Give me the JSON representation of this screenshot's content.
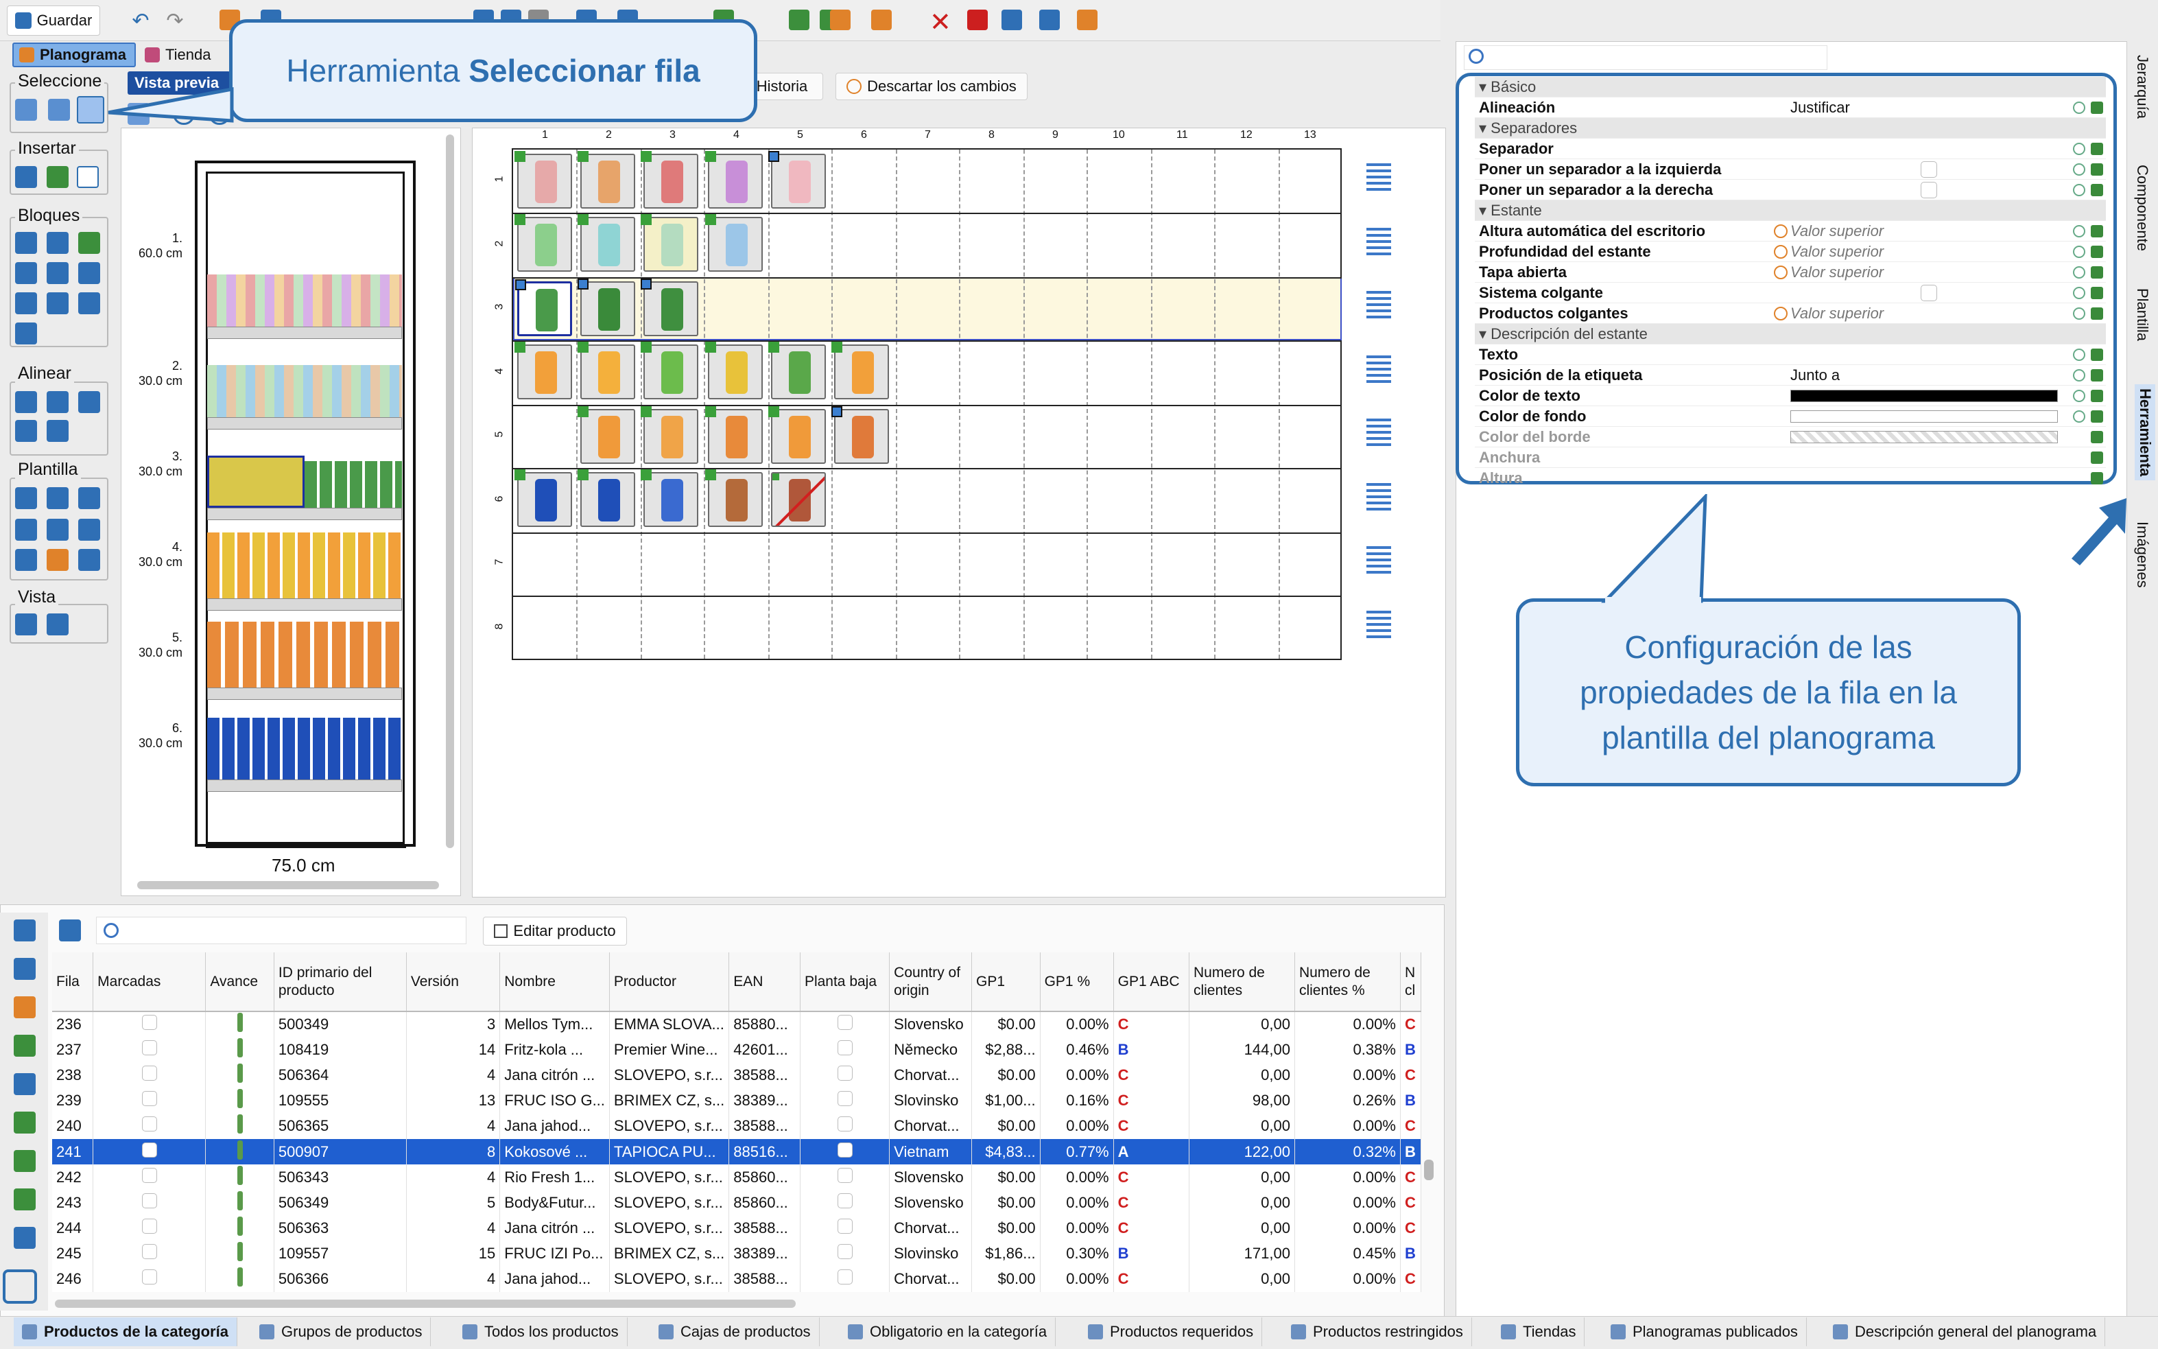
{
  "toolbar": {
    "save_label": "Guardar",
    "tab_planogram": "Planograma",
    "tab_store": "Tienda",
    "subtab_preview": "Vista previa",
    "history_label": "Historia",
    "discard_label": "Descartar los cambios"
  },
  "left_tools": {
    "groups": [
      "Seleccione",
      "Insertar",
      "Bloques",
      "Alinear",
      "Plantilla",
      "Vista"
    ]
  },
  "preview": {
    "shelves": [
      {
        "label": "1.",
        "height": "60.0 cm"
      },
      {
        "label": "2.",
        "height": "30.0 cm"
      },
      {
        "label": "3.",
        "height": "30.0 cm"
      },
      {
        "label": "4.",
        "height": "30.0 cm"
      },
      {
        "label": "5.",
        "height": "30.0 cm"
      },
      {
        "label": "6.",
        "height": "30.0 cm"
      }
    ],
    "width_label": "75.0 cm"
  },
  "grid": {
    "columns": [
      "1",
      "2",
      "3",
      "4",
      "5",
      "6",
      "7",
      "8",
      "9",
      "10",
      "11",
      "12",
      "13"
    ],
    "rows": [
      "1",
      "2",
      "3",
      "4",
      "5",
      "6",
      "7",
      "8"
    ]
  },
  "callouts": {
    "tool_title_prefix": "Herramienta ",
    "tool_title_bold": "Seleccionar fila",
    "config_text": "Configuración de las propiedades de la fila en la plantilla del planograma"
  },
  "properties": {
    "rows": [
      {
        "kind": "section",
        "name": "Básico"
      },
      {
        "kind": "prop",
        "name": "Alineación",
        "value": "Justificar"
      },
      {
        "kind": "section",
        "name": "Separadores"
      },
      {
        "kind": "prop",
        "name": "Separador",
        "value": ""
      },
      {
        "kind": "prop",
        "name": "Poner un separador a la izquierda",
        "value": "",
        "checkbox": true
      },
      {
        "kind": "prop",
        "name": "Poner un separador a la derecha",
        "value": "",
        "checkbox": true
      },
      {
        "kind": "section",
        "name": "Estante"
      },
      {
        "kind": "prop",
        "name": "Altura automática del escritorio",
        "value": "Valor superior",
        "inherit": true
      },
      {
        "kind": "prop",
        "name": "Profundidad del estante",
        "value": "Valor superior",
        "inherit": true
      },
      {
        "kind": "prop",
        "name": "Tapa abierta",
        "value": "Valor superior",
        "inherit": true
      },
      {
        "kind": "prop",
        "name": "Sistema colgante",
        "value": "",
        "checkbox": true
      },
      {
        "kind": "prop",
        "name": "Productos colgantes",
        "value": "Valor superior",
        "inherit": true
      },
      {
        "kind": "section",
        "name": "Descripción del estante"
      },
      {
        "kind": "prop",
        "name": "Texto",
        "value": ""
      },
      {
        "kind": "prop",
        "name": "Posición de la etiqueta",
        "value": "Junto a"
      },
      {
        "kind": "prop",
        "name": "Color de texto",
        "value": "",
        "swatch": "#000000"
      },
      {
        "kind": "prop",
        "name": "Color de fondo",
        "value": "",
        "swatch": "#ffffff"
      },
      {
        "kind": "prop",
        "name": "Color del borde",
        "value": "",
        "swatch": "checker",
        "disabled": true
      },
      {
        "kind": "prop",
        "name": "Anchura",
        "value": "",
        "disabled": true
      },
      {
        "kind": "prop",
        "name": "Altura",
        "value": "",
        "disabled": true
      }
    ]
  },
  "right_tabs": [
    "Jerarquía",
    "Componente",
    "Plantilla",
    "Herramienta",
    "Imágenes"
  ],
  "products_table": {
    "edit_button": "Editar producto",
    "headers": [
      "Fila",
      "Marcadas",
      "Avance",
      "ID primario del producto",
      "Versión",
      "Nombre",
      "Productor",
      "EAN",
      "Planta baja",
      "Country of origin",
      "GP1",
      "GP1 %",
      "GP1 ABC",
      "Numero de clientes",
      "Numero de clientes %",
      "N cl"
    ],
    "rows": [
      {
        "fila": "236",
        "id": "500349",
        "ver": "3",
        "name": "Mellos Tym...",
        "prod": "EMMA SLOVA...",
        "ean": "85880...",
        "country": "Slovensko",
        "gp1": "$0.00",
        "gp1p": "0.00%",
        "abc": "C",
        "clients": "0,00",
        "clientsp": "0.00%",
        "ncl": "C"
      },
      {
        "fila": "237",
        "id": "108419",
        "ver": "14",
        "name": "Fritz-kola ...",
        "prod": "Premier Wine...",
        "ean": "42601...",
        "country": "Německo",
        "gp1": "$2,88...",
        "gp1p": "0.46%",
        "abc": "B",
        "clients": "144,00",
        "clientsp": "0.38%",
        "ncl": "B"
      },
      {
        "fila": "238",
        "id": "506364",
        "ver": "4",
        "name": "Jana citrón ...",
        "prod": "SLOVEPO, s.r...",
        "ean": "38588...",
        "country": "Chorvat...",
        "gp1": "$0.00",
        "gp1p": "0.00%",
        "abc": "C",
        "clients": "0,00",
        "clientsp": "0.00%",
        "ncl": "C"
      },
      {
        "fila": "239",
        "id": "109555",
        "ver": "13",
        "name": "FRUC ISO G...",
        "prod": "BRIMEX CZ, s...",
        "ean": "38389...",
        "country": "Slovinsko",
        "gp1": "$1,00...",
        "gp1p": "0.16%",
        "abc": "C",
        "clients": "98,00",
        "clientsp": "0.26%",
        "ncl": "B"
      },
      {
        "fila": "240",
        "id": "506365",
        "ver": "4",
        "name": "Jana jahod...",
        "prod": "SLOVEPO, s.r...",
        "ean": "38588...",
        "country": "Chorvat...",
        "gp1": "$0.00",
        "gp1p": "0.00%",
        "abc": "C",
        "clients": "0,00",
        "clientsp": "0.00%",
        "ncl": "C"
      },
      {
        "fila": "241",
        "id": "500907",
        "ver": "8",
        "name": "Kokosové ...",
        "prod": "TAPIOCA PU...",
        "ean": "88516...",
        "country": "Vietnam",
        "gp1": "$4,83...",
        "gp1p": "0.77%",
        "abc": "A",
        "clients": "122,00",
        "clientsp": "0.32%",
        "ncl": "B",
        "selected": true
      },
      {
        "fila": "242",
        "id": "506343",
        "ver": "4",
        "name": "Rio Fresh 1...",
        "prod": "SLOVEPO, s.r...",
        "ean": "85860...",
        "country": "Slovensko",
        "gp1": "$0.00",
        "gp1p": "0.00%",
        "abc": "C",
        "clients": "0,00",
        "clientsp": "0.00%",
        "ncl": "C"
      },
      {
        "fila": "243",
        "id": "506349",
        "ver": "5",
        "name": "Body&Futur...",
        "prod": "SLOVEPO, s.r...",
        "ean": "85860...",
        "country": "Slovensko",
        "gp1": "$0.00",
        "gp1p": "0.00%",
        "abc": "C",
        "clients": "0,00",
        "clientsp": "0.00%",
        "ncl": "C"
      },
      {
        "fila": "244",
        "id": "506363",
        "ver": "4",
        "name": "Jana citrón ...",
        "prod": "SLOVEPO, s.r...",
        "ean": "38588...",
        "country": "Chorvat...",
        "gp1": "$0.00",
        "gp1p": "0.00%",
        "abc": "C",
        "clients": "0,00",
        "clientsp": "0.00%",
        "ncl": "C"
      },
      {
        "fila": "245",
        "id": "109557",
        "ver": "15",
        "name": "FRUC IZI Po...",
        "prod": "BRIMEX CZ, s...",
        "ean": "38389...",
        "country": "Slovinsko",
        "gp1": "$1,86...",
        "gp1p": "0.30%",
        "abc": "B",
        "clients": "171,00",
        "clientsp": "0.45%",
        "ncl": "B"
      },
      {
        "fila": "246",
        "id": "506366",
        "ver": "4",
        "name": "Jana jahod...",
        "prod": "SLOVEPO, s.r...",
        "ean": "38588...",
        "country": "Chorvat...",
        "gp1": "$0.00",
        "gp1p": "0.00%",
        "abc": "C",
        "clients": "0,00",
        "clientsp": "0.00%",
        "ncl": "C"
      }
    ]
  },
  "bottom_tabs": [
    "Productos de la categoría",
    "Grupos de productos",
    "Todos los productos",
    "Cajas de productos",
    "Obligatorio en la categoría",
    "Productos requeridos",
    "Productos restringidos",
    "Tiendas",
    "Planogramas publicados",
    "Descripción general del planograma"
  ],
  "colors": {
    "accent": "#2e6fb0",
    "selection": "#1f5fd0",
    "row_highlight": "#fdf8df"
  }
}
